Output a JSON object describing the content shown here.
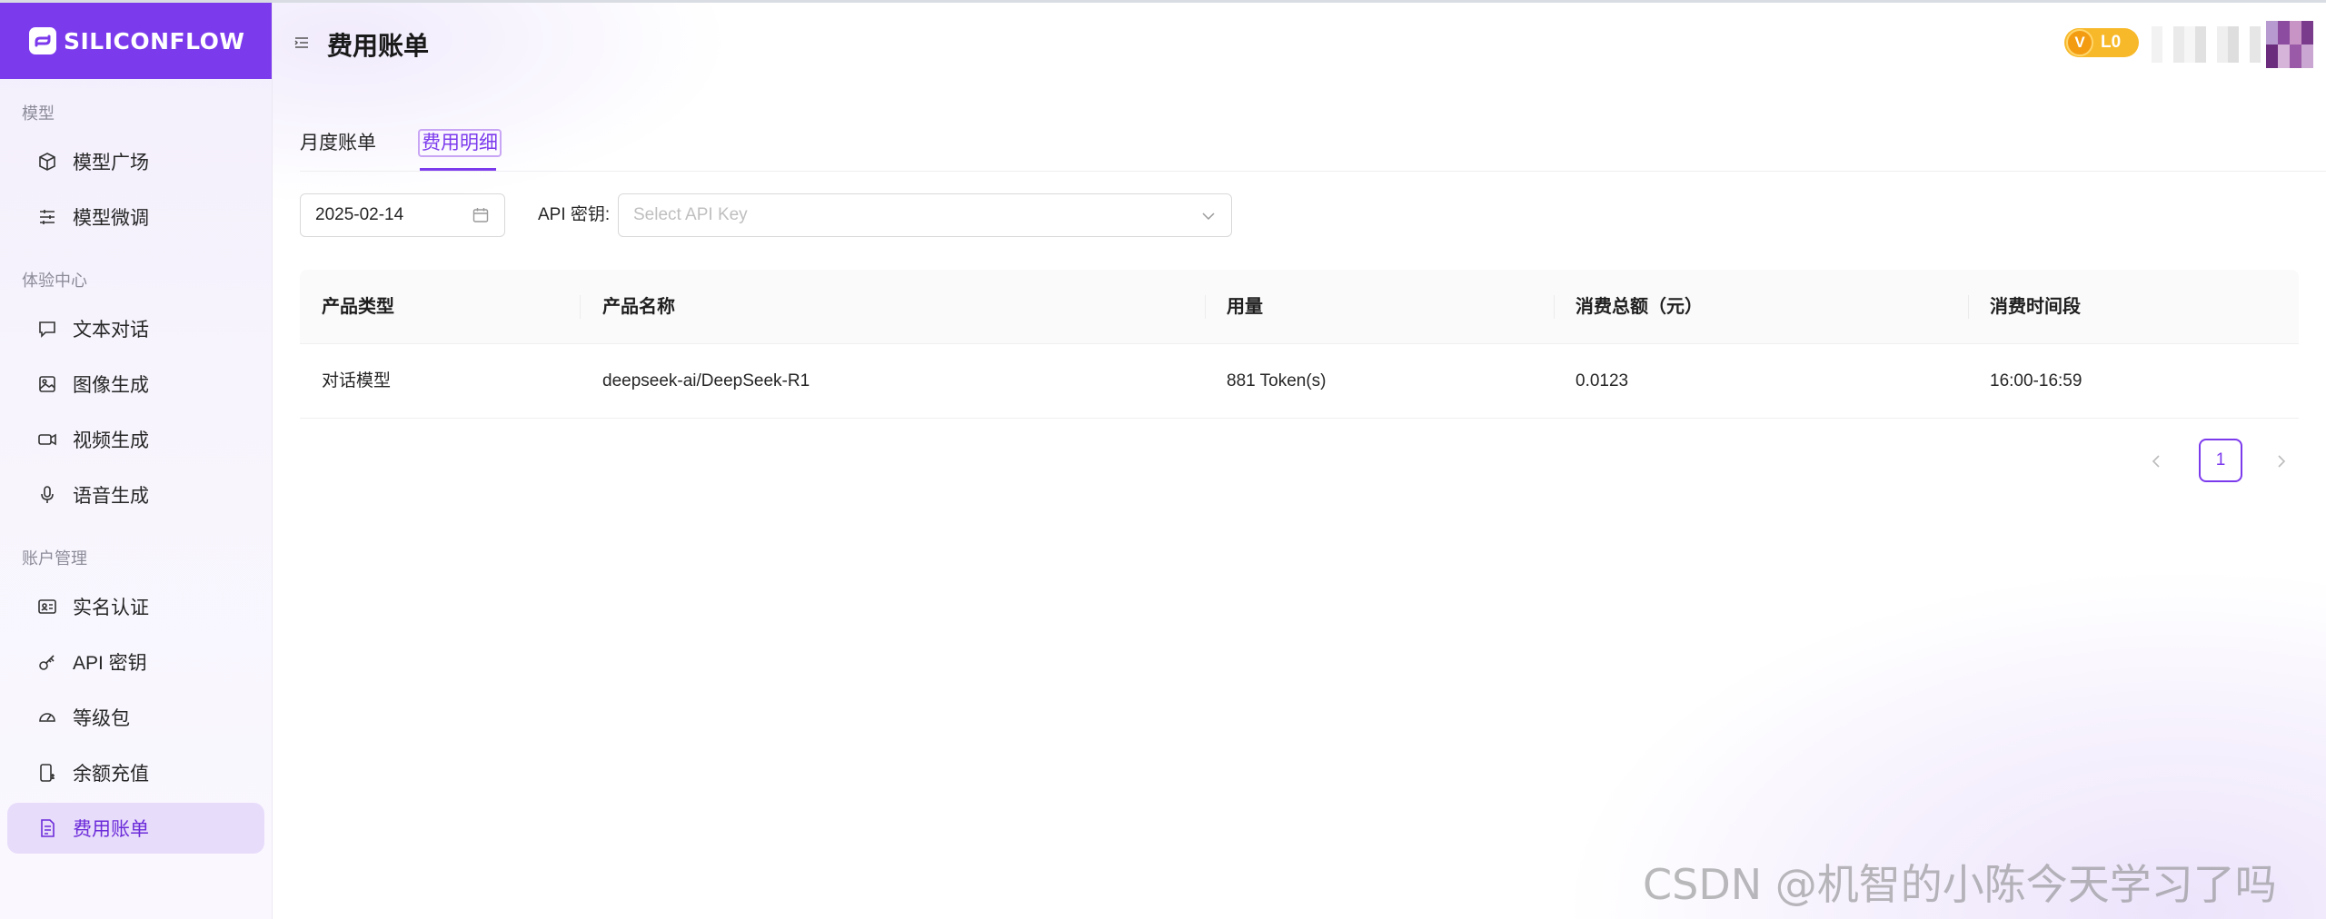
{
  "brand": {
    "name": "SILICONFLOW"
  },
  "sidebar": {
    "groups": [
      {
        "title": "模型",
        "items": [
          {
            "label": "模型广场",
            "icon": "cube-icon"
          },
          {
            "label": "模型微调",
            "icon": "sliders-icon"
          }
        ]
      },
      {
        "title": "体验中心",
        "items": [
          {
            "label": "文本对话",
            "icon": "chat-bubble-icon"
          },
          {
            "label": "图像生成",
            "icon": "image-icon"
          },
          {
            "label": "视频生成",
            "icon": "video-camera-icon"
          },
          {
            "label": "语音生成",
            "icon": "microphone-icon"
          }
        ]
      },
      {
        "title": "账户管理",
        "items": [
          {
            "label": "实名认证",
            "icon": "id-card-icon"
          },
          {
            "label": "API 密钥",
            "icon": "key-icon"
          },
          {
            "label": "等级包",
            "icon": "gauge-icon"
          },
          {
            "label": "余额充值",
            "icon": "wallet-icon"
          },
          {
            "label": "费用账单",
            "icon": "bill-icon",
            "active": true
          }
        ]
      }
    ]
  },
  "header": {
    "title": "费用账单",
    "level_badge": {
      "icon_letter": "V",
      "level": "L0"
    }
  },
  "tabs": [
    {
      "label": "月度账单",
      "active": false
    },
    {
      "label": "费用明细",
      "active": true
    }
  ],
  "filters": {
    "date": "2025-02-14",
    "api_label": "API 密钥:",
    "api_placeholder": "Select API Key"
  },
  "table": {
    "columns": [
      "产品类型",
      "产品名称",
      "用量",
      "消费总额（元）",
      "消费时间段"
    ],
    "rows": [
      [
        "对话模型",
        "deepseek-ai/DeepSeek-R1",
        "881 Token(s)",
        "0.0123",
        "16:00-16:59"
      ]
    ]
  },
  "pagination": {
    "current": "1"
  },
  "watermark": "CSDN @机智的小陈今天学习了吗",
  "colors": {
    "accent": "#7c3aed",
    "badge": "#f7b92a"
  }
}
